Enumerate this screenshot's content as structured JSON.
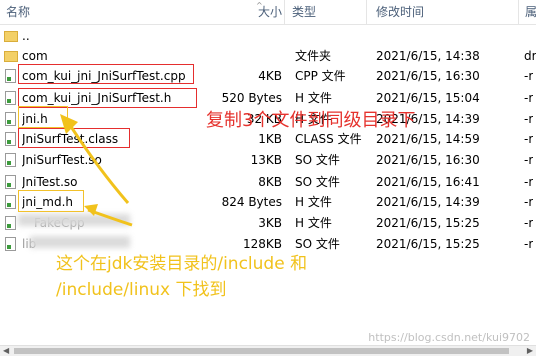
{
  "columns": {
    "name": "名称",
    "size": "大小",
    "type": "类型",
    "modified": "修改时间",
    "attributes": "属"
  },
  "rows": [
    {
      "name": "..",
      "size": "",
      "type": "",
      "modified": "",
      "attr": "",
      "icon": "folder-icon"
    },
    {
      "name": "com",
      "size": "",
      "type": "文件夹",
      "modified": "2021/6/15, 14:38",
      "attr": "dr",
      "icon": "folder-icon"
    },
    {
      "name": "com_kui_jni_JniSurfTest.cpp",
      "size": "4KB",
      "type": "CPP 文件",
      "modified": "2021/6/15, 16:30",
      "attr": "-r",
      "icon": "file-icon"
    },
    {
      "name": "com_kui_jni_JniSurfTest.h",
      "size": "520 Bytes",
      "type": "H 文件",
      "modified": "2021/6/15, 15:04",
      "attr": "-r",
      "icon": "file-icon"
    },
    {
      "name": "jni.h",
      "size": "32 KB",
      "type": "H 文件",
      "modified": "2021/6/15, 14:39",
      "attr": "-r",
      "icon": "file-icon"
    },
    {
      "name": "JniSurfTest.class",
      "size": "1KB",
      "type": "CLASS 文件",
      "modified": "2021/6/15, 14:59",
      "attr": "-r",
      "icon": "file-icon"
    },
    {
      "name": "JniSurfTest.so",
      "size": "13KB",
      "type": "SO 文件",
      "modified": "2021/6/15, 16:30",
      "attr": "-r",
      "icon": "file-icon"
    },
    {
      "name": "JniTest.so",
      "size": "8KB",
      "type": "SO 文件",
      "modified": "2021/6/15, 16:41",
      "attr": "-r",
      "icon": "file-icon"
    },
    {
      "name": "jni_md.h",
      "size": "824 Bytes",
      "type": "H 文件",
      "modified": "2021/6/15, 14:39",
      "attr": "-r",
      "icon": "file-icon"
    },
    {
      "name": "FakeCpp",
      "size": "3KB",
      "type": "H 文件",
      "modified": "2021/6/15, 15:25",
      "attr": "-r",
      "icon": "file-icon"
    },
    {
      "name": "lib",
      "size": "128KB",
      "type": "SO 文件",
      "modified": "2021/6/15, 15:25",
      "attr": "-r",
      "icon": "file-icon"
    }
  ],
  "annotations": {
    "copy_note": "复制3个文件到同级目录下",
    "jdk_note_line1": "这个在jdk安装目录的/include 和",
    "jdk_note_line2": "/include/linux  下找到"
  },
  "watermark": "https://blog.csdn.net/kui9702",
  "colors": {
    "header_text": "#4c607a",
    "annotation_red": "#e5322d",
    "annotation_yellow": "#f1c21c"
  }
}
